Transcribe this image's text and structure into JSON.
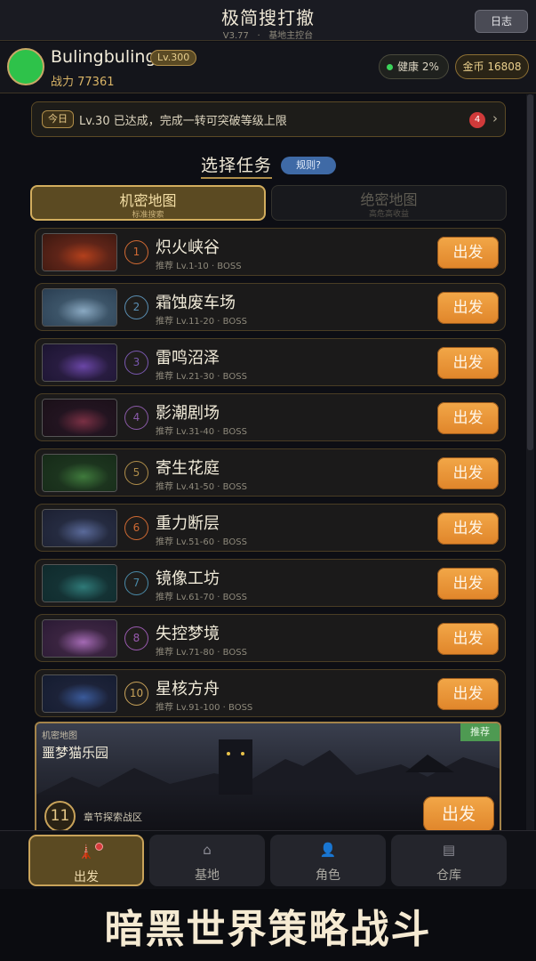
{
  "header": {
    "title": "极简搜打撤",
    "version": "V3.77",
    "separator": "·",
    "location": "基地主控台",
    "log_button": "日志"
  },
  "player": {
    "name": "Bulingbuling",
    "level": "Lv.300",
    "power": "战力 77361",
    "health": "健康 2%",
    "gold": "金币 16808",
    "avatar_color": "#2ec24a"
  },
  "notice": {
    "tag": "今日",
    "text": "Lv.30 已达成，完成一转可突破等级上限",
    "badge": "4",
    "arrow": "›"
  },
  "section": {
    "title": "选择任务",
    "rules_label": "规则?"
  },
  "tabs": [
    {
      "title": "机密地图",
      "subtitle": "标准搜索",
      "active": true
    },
    {
      "title": "绝密地图",
      "subtitle": "高危高收益",
      "active": false
    }
  ],
  "missions": [
    {
      "num": "1",
      "name": "炽火峡谷",
      "rec": "推荐 Lv.1-10 · BOSS",
      "go": "出发",
      "accent": "#d26a33",
      "thumb": [
        "#3a1810",
        "#b3401c",
        "#5e2418"
      ]
    },
    {
      "num": "2",
      "name": "霜蚀废车场",
      "rec": "推荐 Lv.11-20 · BOSS",
      "go": "出发",
      "accent": "#5a8fb4",
      "thumb": [
        "#2a3e52",
        "#8aa9c2",
        "#3c5468"
      ]
    },
    {
      "num": "3",
      "name": "雷鸣沼泽",
      "rec": "推荐 Lv.21-30 · BOSS",
      "go": "出发",
      "accent": "#7a58b0",
      "thumb": [
        "#1b1430",
        "#6a46a6",
        "#281c40"
      ]
    },
    {
      "num": "4",
      "name": "影潮剧场",
      "rec": "推荐 Lv.31-40 · BOSS",
      "go": "出发",
      "accent": "#8a5aa8",
      "thumb": [
        "#1a1018",
        "#7a3044",
        "#221420"
      ]
    },
    {
      "num": "5",
      "name": "寄生花庭",
      "rec": "推荐 Lv.41-50 · BOSS",
      "go": "出发",
      "accent": "#b08e4a",
      "thumb": [
        "#162a18",
        "#3f7a3c",
        "#1c341e"
      ]
    },
    {
      "num": "6",
      "name": "重力断层",
      "rec": "推荐 Lv.51-60 · BOSS",
      "go": "出发",
      "accent": "#d06a33",
      "thumb": [
        "#1c2032",
        "#5a6a9a",
        "#252b40"
      ]
    },
    {
      "num": "7",
      "name": "镜像工坊",
      "rec": "推荐 Lv.61-70 · BOSS",
      "go": "出发",
      "accent": "#4a8aa8",
      "thumb": [
        "#0f2a2c",
        "#2f7a78",
        "#143234"
      ]
    },
    {
      "num": "8",
      "name": "失控梦境",
      "rec": "推荐 Lv.71-80 · BOSS",
      "go": "出发",
      "accent": "#9a5ab0",
      "thumb": [
        "#2a1a34",
        "#a46ab4",
        "#3a2440"
      ]
    },
    {
      "num": "10",
      "name": "星核方舟",
      "rec": "推荐 Lv.91-100 · BOSS",
      "go": "出发",
      "accent": "#c9a35a",
      "thumb": [
        "#141c30",
        "#3a5a9a",
        "#1c2238"
      ]
    }
  ],
  "featured": {
    "label": "机密地图",
    "name": "噩梦猫乐园",
    "badge": "推荐",
    "num": "11",
    "desc": "章节探索战区",
    "go": "出发"
  },
  "nav": [
    {
      "label": "出发",
      "icon": "🗼",
      "active": true
    },
    {
      "label": "基地",
      "icon": "⌂",
      "active": false
    },
    {
      "label": "角色",
      "icon": "👤",
      "active": false
    },
    {
      "label": "仓库",
      "icon": "▤",
      "active": false
    }
  ],
  "banner": {
    "text": "暗黑世界策略战斗"
  }
}
